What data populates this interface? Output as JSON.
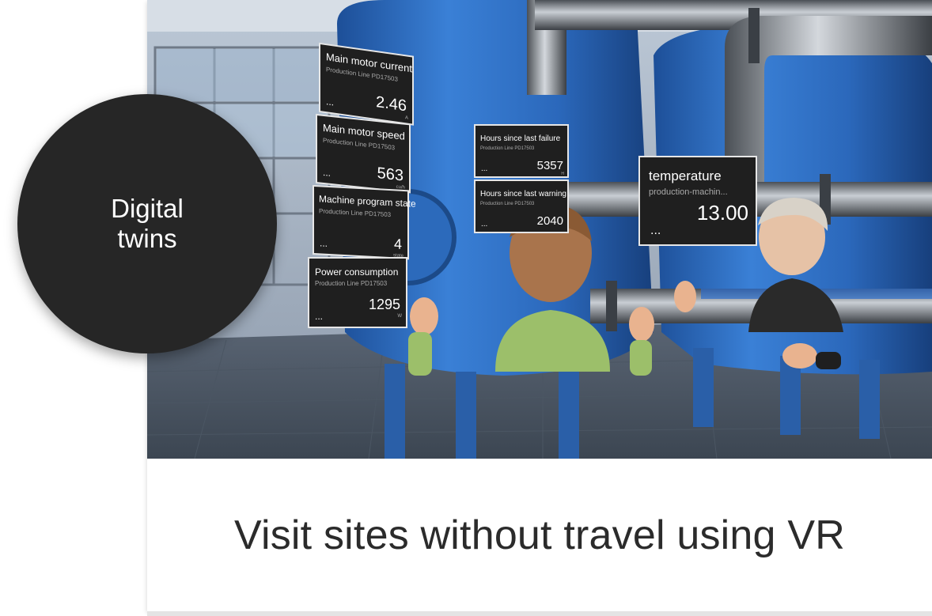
{
  "badge": {
    "label": "Digital twins"
  },
  "caption": {
    "text": "Visit sites without travel using VR"
  },
  "panels": {
    "current": {
      "title": "Main motor current",
      "subtitle": "Production Line PD17503",
      "dots": "...",
      "value": "2.46",
      "unit": "A"
    },
    "speed": {
      "title": "Main motor speed",
      "subtitle": "Production Line PD17503",
      "dots": "...",
      "value": "563",
      "unit": "cu/h"
    },
    "program": {
      "title": "Machine program state",
      "subtitle": "Production Line PD17503",
      "dots": "...",
      "value": "4",
      "unit": "state"
    },
    "power": {
      "title": "Power consumption",
      "subtitle": "Production Line PD17503",
      "dots": "...",
      "value": "1295",
      "unit": "W"
    },
    "failure": {
      "title": "Hours since last failure",
      "subtitle": "Production Line PD17503",
      "dots": "...",
      "value": "5357",
      "unit": "H"
    },
    "warning": {
      "title": "Hours since last warning",
      "subtitle": "Production Line PD17503",
      "dots": "...",
      "value": "2040",
      "unit": ""
    },
    "temperature": {
      "title": "temperature",
      "subtitle": "production-machin...",
      "dots": "...",
      "value": "13.00",
      "unit": ""
    }
  },
  "colors": {
    "tank": "#2d6fc4",
    "panel": "#1f1f1f",
    "badge": "#262626"
  }
}
